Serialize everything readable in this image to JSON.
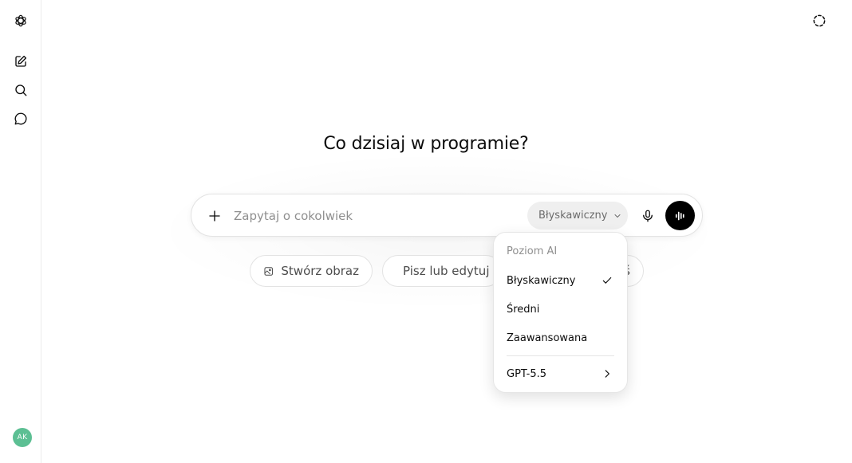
{
  "headline": "Co dzisiaj w programie?",
  "composer": {
    "placeholder": "Zapytaj o cokolwiek",
    "model_selector_label": "Błyskawiczny"
  },
  "chips": [
    {
      "label": "Stwórz obraz",
      "icon": "image-icon"
    },
    {
      "label": "Pisz lub edytuj",
      "icon": "pencil-icon"
    },
    {
      "label": "ś"
    }
  ],
  "dropdown": {
    "header": "Poziom AI",
    "items": [
      {
        "label": "Błyskawiczny",
        "selected": true
      },
      {
        "label": "Średni",
        "selected": false
      },
      {
        "label": "Zaawansowana",
        "selected": false
      }
    ],
    "submenu_label": "GPT-5.5"
  },
  "user": {
    "initials": "AK",
    "avatar_color": "#5cbf93"
  },
  "sidebar_icons": [
    "logo-icon",
    "new-chat-icon",
    "search-icon",
    "chats-icon"
  ]
}
